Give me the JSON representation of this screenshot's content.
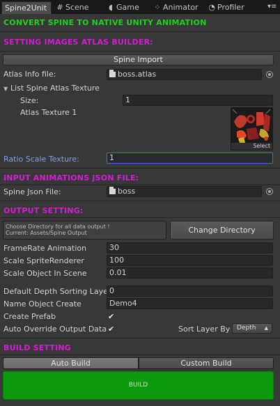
{
  "tabs": [
    {
      "label": "Spine2Unit",
      "icon": ""
    },
    {
      "label": "Scene",
      "icon": "grid-icon"
    },
    {
      "label": "Game",
      "icon": "pacman-icon"
    },
    {
      "label": "Animator",
      "icon": "animator-icon"
    },
    {
      "label": "Profiler",
      "icon": "profiler-icon"
    }
  ],
  "header": {
    "title": "CONVERT SPINE TO NATIVE UNITY ANIMATION"
  },
  "atlas_section": {
    "title": "SETTING IMAGES ATLAS BUILDER:",
    "import_button": "Spine Import",
    "atlas_info_label": "Atlas Info file:",
    "atlas_info_value": "boss.atlas",
    "list_label": "List Spine Atlas Texture",
    "size_label": "Size:",
    "size_value": "1",
    "texture_label": "Atlas Texture 1",
    "texture_select": "Select",
    "ratio_label": "Ratio Scale Texture:",
    "ratio_value": "1"
  },
  "json_section": {
    "title": "INPUT ANIMATIONS JSON FILE:",
    "json_label": "Spine Json File:",
    "json_value": "boss"
  },
  "output_section": {
    "title": "OUTPUT SETTING:",
    "info_line1": "Choose Directory for all data output !",
    "info_line2": "Current: Assets/Spine Output",
    "change_dir_button": "Change Directory",
    "framerate_label": "FrameRate Animation",
    "framerate_value": "30",
    "scale_sprite_label": "Scale SpriteRenderer",
    "scale_sprite_value": "100",
    "scale_object_label": "Scale Object In Scene",
    "scale_object_value": "0.01",
    "depth_label": "Default Depth Sorting Layer",
    "depth_value": "0",
    "name_label": "Name Object Create",
    "name_value": "Demo4",
    "prefab_label": "Create Prefab",
    "prefab_checked": true,
    "override_label": "Auto Override Output Data",
    "override_checked": true,
    "sort_label": "Sort Layer By",
    "sort_value": "Depth"
  },
  "build_section": {
    "title": "BUILD SETTING",
    "auto_build": "Auto Build",
    "custom_build": "Custom Build",
    "build_button": "BUILD"
  },
  "colors": {
    "green": "#1ed31e",
    "magenta": "#d31ed3",
    "accent_blue": "#3e72c2",
    "build": "#0b9a0b"
  }
}
